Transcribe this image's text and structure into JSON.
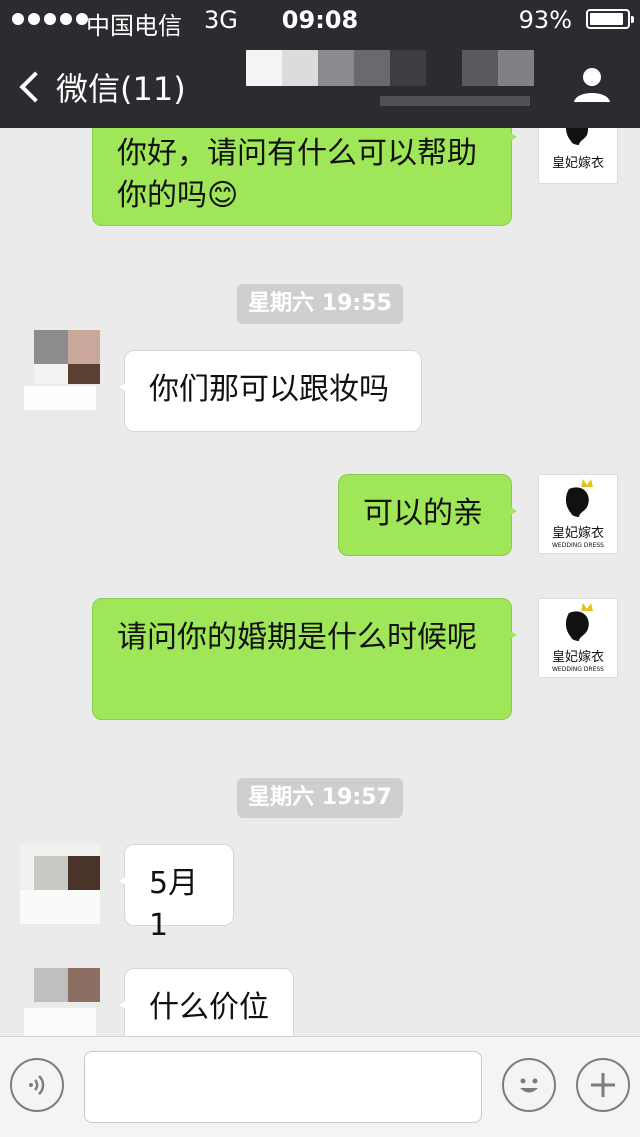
{
  "status_bar": {
    "carrier": "中国电信",
    "network": "3G",
    "time": "09:08",
    "battery": "93%",
    "battery_level": 0.93
  },
  "nav": {
    "back_label": "微信(11)"
  },
  "messages": [
    {
      "id": "m1",
      "side": "out",
      "text": "你好，请问有什么可以帮助你的吗😊"
    },
    {
      "id": "t1",
      "type": "time",
      "text": "星期六 19:55"
    },
    {
      "id": "m2",
      "side": "in",
      "text": "你们那可以跟妆吗"
    },
    {
      "id": "m3",
      "side": "out",
      "text": "可以的亲"
    },
    {
      "id": "m4",
      "side": "out",
      "text": "请问你的婚期是什么时候呢"
    },
    {
      "id": "t2",
      "type": "time",
      "text": "星期六 19:57"
    },
    {
      "id": "m5",
      "side": "in",
      "text": "5月1"
    },
    {
      "id": "m6",
      "side": "in",
      "text": "什么价位"
    }
  ],
  "self_avatar": {
    "logo_text": "皇妃嫁衣",
    "logo_subtext": "WEDDING DRESS"
  },
  "input": {
    "value": "",
    "placeholder": ""
  },
  "colors": {
    "nav_bg": "#2b2b30",
    "chat_bg": "#ebebeb",
    "out_bubble": "#9fe658",
    "in_bubble": "#ffffff",
    "time_badge": "#cfcfcf"
  },
  "icons": {
    "back": "chevron-left-icon",
    "profile": "person-icon",
    "voice": "voice-icon",
    "emoji": "emoji-icon",
    "add": "plus-icon"
  }
}
